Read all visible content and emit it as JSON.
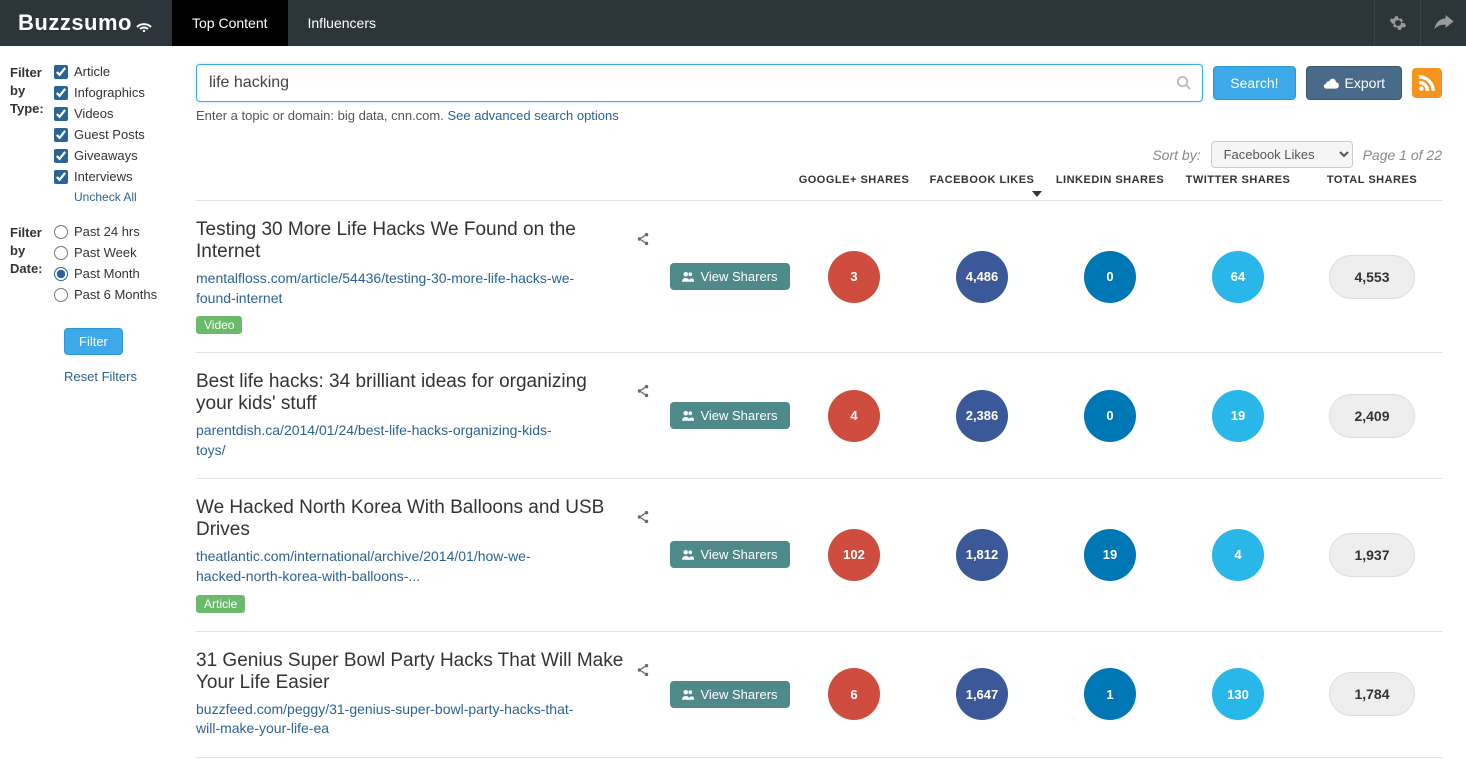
{
  "brand": "Buzzsumo",
  "nav": {
    "tab_top_content": "Top Content",
    "tab_influencers": "Influencers"
  },
  "search": {
    "value": "life hacking",
    "button": "Search!",
    "export": "Export",
    "hint_prefix": "Enter a topic or domain: big data, cnn.com. ",
    "hint_link": "See advanced search options"
  },
  "sidebar": {
    "type_title": "Filter by Type:",
    "date_title": "Filter by Date:",
    "types": [
      "Article",
      "Infographics",
      "Videos",
      "Guest Posts",
      "Giveaways",
      "Interviews"
    ],
    "uncheck": "Uncheck All",
    "dates": [
      "Past 24 hrs",
      "Past Week",
      "Past Month",
      "Past 6 Months"
    ],
    "date_selected_index": 2,
    "filter_btn": "Filter",
    "reset": "Reset Filters"
  },
  "sort": {
    "label": "Sort by:",
    "selected": "Facebook Likes",
    "pageinfo": "Page 1 of 22"
  },
  "columns": {
    "google": "GOOGLE+ SHARES",
    "facebook": "FACEBOOK LIKES",
    "linkedin": "LINKEDIN SHARES",
    "twitter": "TWITTER SHARES",
    "total": "TOTAL SHARES"
  },
  "view_sharers": "View Sharers",
  "rows": [
    {
      "title": "Testing 30 More Life Hacks We Found on the Internet",
      "url": "mentalfloss.com/article/54436/testing-30-more-life-hacks-we-found-internet",
      "tag": "Video",
      "google": "3",
      "facebook": "4,486",
      "linkedin": "0",
      "twitter": "64",
      "total": "4,553"
    },
    {
      "title": "Best life hacks: 34 brilliant ideas for organizing your kids' stuff",
      "url": "parentdish.ca/2014/01/24/best-life-hacks-organizing-kids-toys/",
      "tag": "",
      "google": "4",
      "facebook": "2,386",
      "linkedin": "0",
      "twitter": "19",
      "total": "2,409"
    },
    {
      "title": "We Hacked North Korea With Balloons and USB Drives",
      "url": "theatlantic.com/international/archive/2014/01/how-we-hacked-north-korea-with-balloons-...",
      "tag": "Article",
      "google": "102",
      "facebook": "1,812",
      "linkedin": "19",
      "twitter": "4",
      "total": "1,937"
    },
    {
      "title": "31 Genius Super Bowl Party Hacks That Will Make Your Life Easier",
      "url": "buzzfeed.com/peggy/31-genius-super-bowl-party-hacks-that-will-make-your-life-ea",
      "tag": "",
      "google": "6",
      "facebook": "1,647",
      "linkedin": "1",
      "twitter": "130",
      "total": "1,784"
    }
  ]
}
